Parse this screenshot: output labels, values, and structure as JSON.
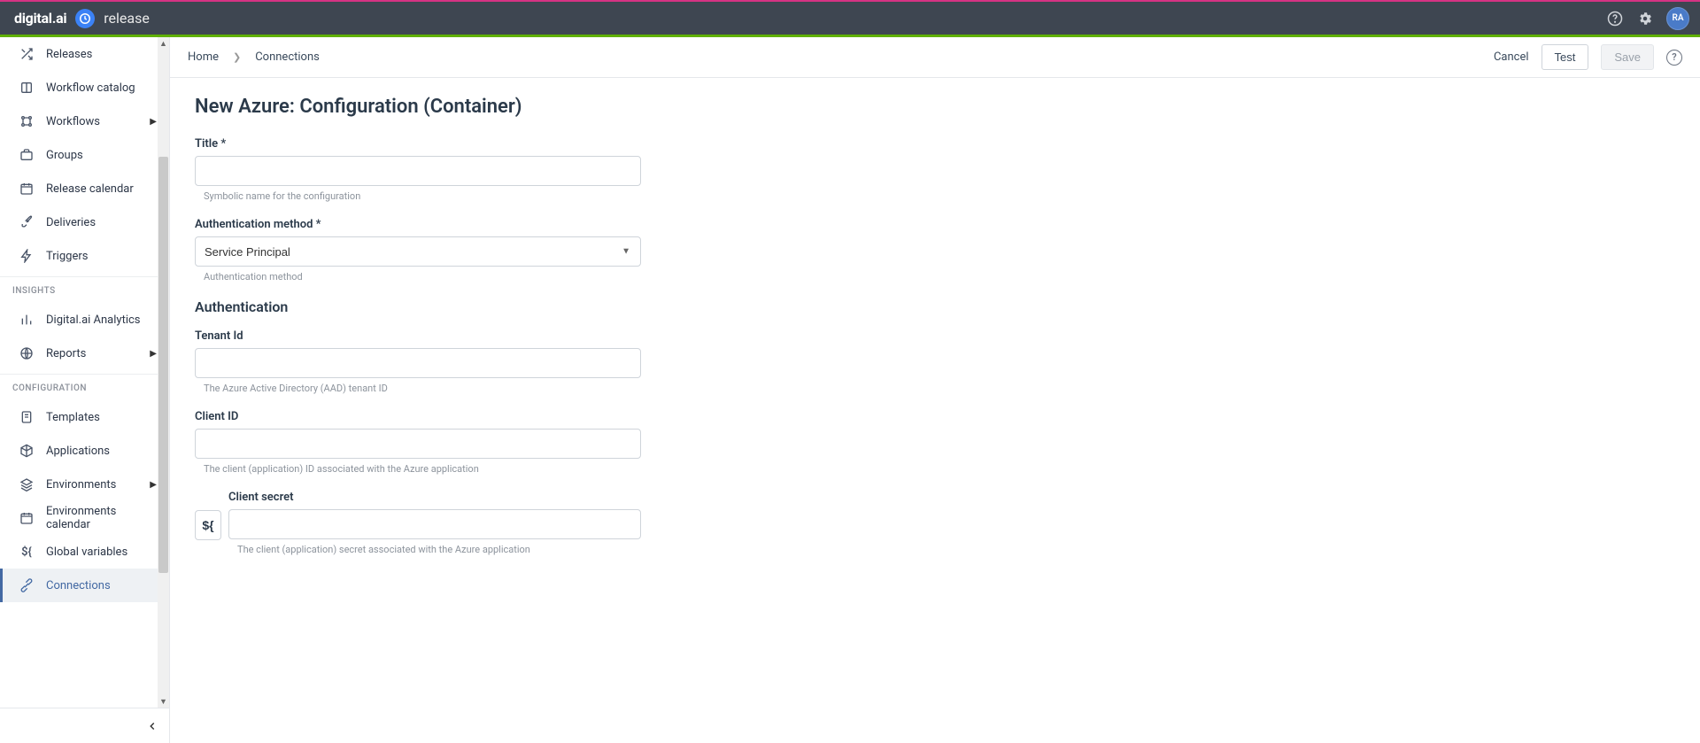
{
  "brand": {
    "company": "digital.ai",
    "product": "release"
  },
  "topbar": {
    "avatar_initials": "RA"
  },
  "sidebar": {
    "items": [
      {
        "label": "Releases",
        "icon": "shuffle"
      },
      {
        "label": "Workflow catalog",
        "icon": "book"
      },
      {
        "label": "Workflows",
        "icon": "workflow",
        "caret": true
      },
      {
        "label": "Groups",
        "icon": "briefcase"
      },
      {
        "label": "Release calendar",
        "icon": "calendar"
      },
      {
        "label": "Deliveries",
        "icon": "rocket"
      },
      {
        "label": "Triggers",
        "icon": "bolt"
      }
    ],
    "section_insights": "INSIGHTS",
    "insights": [
      {
        "label": "Digital.ai Analytics",
        "icon": "bar-chart"
      },
      {
        "label": "Reports",
        "icon": "globe",
        "caret": true
      }
    ],
    "section_config": "CONFIGURATION",
    "config": [
      {
        "label": "Templates",
        "icon": "note"
      },
      {
        "label": "Applications",
        "icon": "cube"
      },
      {
        "label": "Environments",
        "icon": "layers",
        "caret": true
      },
      {
        "label": "Environments calendar",
        "icon": "calendar"
      },
      {
        "label": "Global variables",
        "icon": "var"
      },
      {
        "label": "Connections",
        "icon": "plug",
        "active": true
      }
    ]
  },
  "breadcrumb": {
    "home": "Home",
    "current": "Connections"
  },
  "actions": {
    "cancel": "Cancel",
    "test": "Test",
    "save": "Save"
  },
  "page": {
    "title": "New Azure: Configuration (Container)"
  },
  "form": {
    "title_label": "Title *",
    "title_help": "Symbolic name for the configuration",
    "auth_method_label": "Authentication method *",
    "auth_method_value": "Service Principal",
    "auth_method_help": "Authentication method",
    "auth_section": "Authentication",
    "tenant_label": "Tenant Id",
    "tenant_help": "The Azure Active Directory (AAD) tenant ID",
    "client_id_label": "Client ID",
    "client_id_help": "The client (application) ID associated with the Azure application",
    "client_secret_label": "Client secret",
    "client_secret_help": "The client (application) secret associated with the Azure application",
    "var_button": "${"
  }
}
